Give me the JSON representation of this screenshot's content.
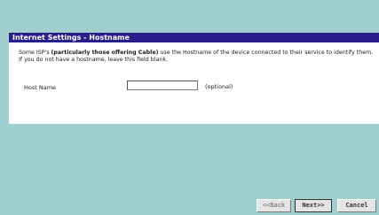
{
  "panel": {
    "title": "Internet Settings - Hostname",
    "description_prefix": "Some ISP's ",
    "description_bold": "(particularly those offering Cable)",
    "description_suffix": " use the Hostname of the device connected to their service to identify them. If you do not have a hostname, leave this field blank."
  },
  "form": {
    "host_name_label": "Host Name",
    "host_name_value": "",
    "optional_label": "(optional)"
  },
  "buttons": {
    "back_label": "<<Back",
    "next_label": "Next>>",
    "cancel_label": "Cancel"
  },
  "colors": {
    "background": "#9fcfcf",
    "header": "#2a1d8c"
  }
}
